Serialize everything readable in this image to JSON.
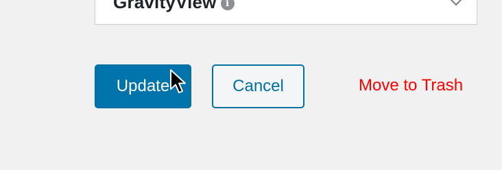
{
  "metabox": {
    "title": "GravityView",
    "info_icon": "info-icon",
    "toggle_icon": "chevron-down-icon"
  },
  "actions": {
    "update_label": "Update",
    "cancel_label": "Cancel",
    "trash_label": "Move to Trash"
  },
  "colors": {
    "primary": "#0073aa",
    "secondary_text": "#0071a1",
    "danger": "#ff0000",
    "background": "#f1f1f1"
  },
  "cursor": {
    "icon": "mouse-pointer-icon"
  }
}
